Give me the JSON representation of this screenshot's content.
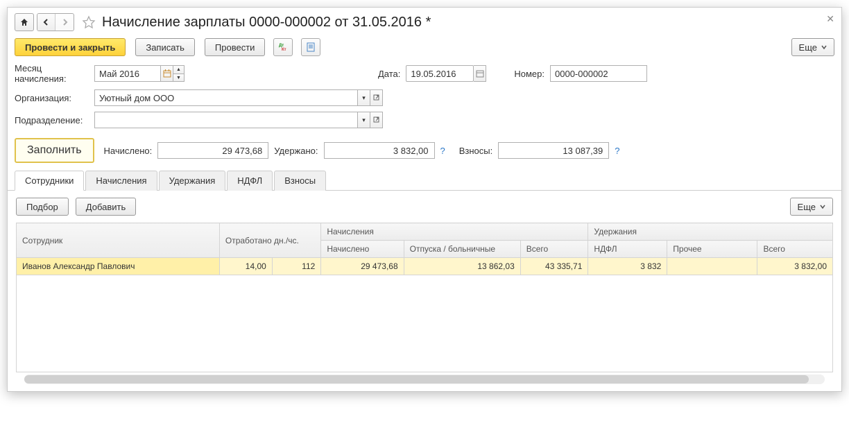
{
  "title": "Начисление зарплаты 0000-000002 от 31.05.2016 *",
  "toolbar": {
    "post_close": "Провести и закрыть",
    "save": "Записать",
    "post": "Провести",
    "more": "Еще"
  },
  "form": {
    "month_label": "Месяц начисления:",
    "month_value": "Май 2016",
    "date_label": "Дата:",
    "date_value": "19.05.2016",
    "number_label": "Номер:",
    "number_value": "0000-000002",
    "org_label": "Организация:",
    "org_value": "Уютный дом ООО",
    "dept_label": "Подразделение:",
    "dept_value": ""
  },
  "fill": {
    "button": "Заполнить",
    "accrued_label": "Начислено:",
    "accrued_value": "29 473,68",
    "withheld_label": "Удержано:",
    "withheld_value": "3 832,00",
    "contrib_label": "Взносы:",
    "contrib_value": "13 087,39"
  },
  "tabs": {
    "employees": "Сотрудники",
    "accruals": "Начисления",
    "deductions": "Удержания",
    "ndfl": "НДФЛ",
    "contrib": "Взносы"
  },
  "subtoolbar": {
    "pick": "Подбор",
    "add": "Добавить",
    "more": "Еще"
  },
  "table": {
    "h_employee": "Сотрудник",
    "h_worked": "Отработано дн./чс.",
    "h_accruals": "Начисления",
    "h_accrued": "Начислено",
    "h_vacation": "Отпуска / больничные",
    "h_total1": "Всего",
    "h_deductions": "Удержания",
    "h_ndfl": "НДФЛ",
    "h_other": "Прочее",
    "h_total2": "Всего",
    "rows": [
      {
        "employee": "Иванов Александр Павлович",
        "days": "14,00",
        "hours": "112",
        "accrued": "29 473,68",
        "vacation": "13 862,03",
        "total_acc": "43 335,71",
        "ndfl": "3 832",
        "other": "",
        "total_ded": "3 832,00"
      }
    ]
  }
}
